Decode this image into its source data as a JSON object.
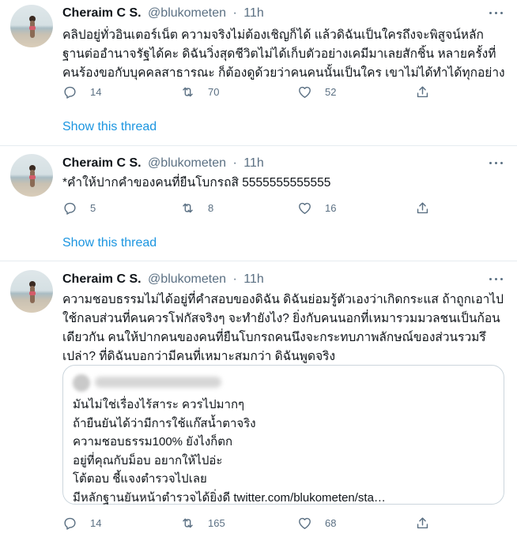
{
  "tweets": [
    {
      "name": "Cheraim C S.",
      "handle": "@blukometen",
      "separator": "·",
      "time": "11h",
      "text_lines": [
        "คลิปอยู่ทั่วอินเตอร์เน็ต ความจริงไม่ต้องเชิญก็ได้ แล้วดิฉันเป็นใครถึงจะพิสูจน์หลัก",
        "ฐานต่ออำนาจรัฐได้คะ ดิฉันวิ่งสุดชีวิตไม่ได้เก็บตัวอย่างเคมีมาเลยสักชิ้น หลายครั้งที่",
        "คนร้องขอกับบุคคลสาธารณะ ก็ต้องดูด้วยว่าคนคนนั้นเป็นใคร เขาไม่ได้ทำได้ทุกอย่าง"
      ],
      "replies": "14",
      "retweets": "70",
      "likes": "52",
      "show_thread": "Show this thread"
    },
    {
      "name": "Cheraim C S.",
      "handle": "@blukometen",
      "separator": "·",
      "time": "11h",
      "text_lines": [
        "*คำให้ปากคำของคนที่ยืนโบกรถสิ 5555555555555"
      ],
      "replies": "5",
      "retweets": "8",
      "likes": "16",
      "show_thread": "Show this thread"
    },
    {
      "name": "Cheraim C S.",
      "handle": "@blukometen",
      "separator": "·",
      "time": "11h",
      "text_lines": [
        "ความชอบธรรมไม่ได้อยู่ที่คำสอบของดิฉัน ดิฉันย่อมรู้ตัวเองว่าเกิดกระแส ถ้าถูกเอาไป",
        "ใช้กลบส่วนที่คนควรโฟกัสจริงๆ จะทำยังไง? ยิ่งกับคนนอกที่เหมารวมมวลชนเป็นก้อน",
        "เดียวกัน คนให้ปากคนของคนที่ยืนโบกรถคนนึงจะกระทบภาพลักษณ์ของส่วนรวมรึ",
        "เปล่า? ที่ดิฉันบอกว่ามีคนที่เหมาะสมกว่า ดิฉันพูดจริง"
      ],
      "quote_lines": [
        "มันไม่ใช่เรื่องไร้สาระ ควรไปมากๆ",
        "ถ้ายืนยันได้ว่ามีการใช้แก๊สน้ำตาจริง",
        "ความชอบธรรม100% ยังไงก็ตก",
        "อยู่ที่คุณกับม็อบ  อยากให้ไปอ่ะ",
        "โต้ตอบ ชี้แจงตำรวจไปเลย",
        "มีหลักฐานยันหน้าตำรวจได้ยิ่งดี twitter.com/blukometen/sta…"
      ],
      "replies": "14",
      "retweets": "165",
      "likes": "68"
    }
  ],
  "icons": {
    "reply": "reply-icon",
    "retweet": "retweet-icon",
    "like": "heart-icon",
    "share": "share-icon",
    "more": "more-icon"
  },
  "colors": {
    "link": "#1b95e0",
    "muted": "#5b7083",
    "text": "#0f1419",
    "divider": "#e6ecf0"
  }
}
